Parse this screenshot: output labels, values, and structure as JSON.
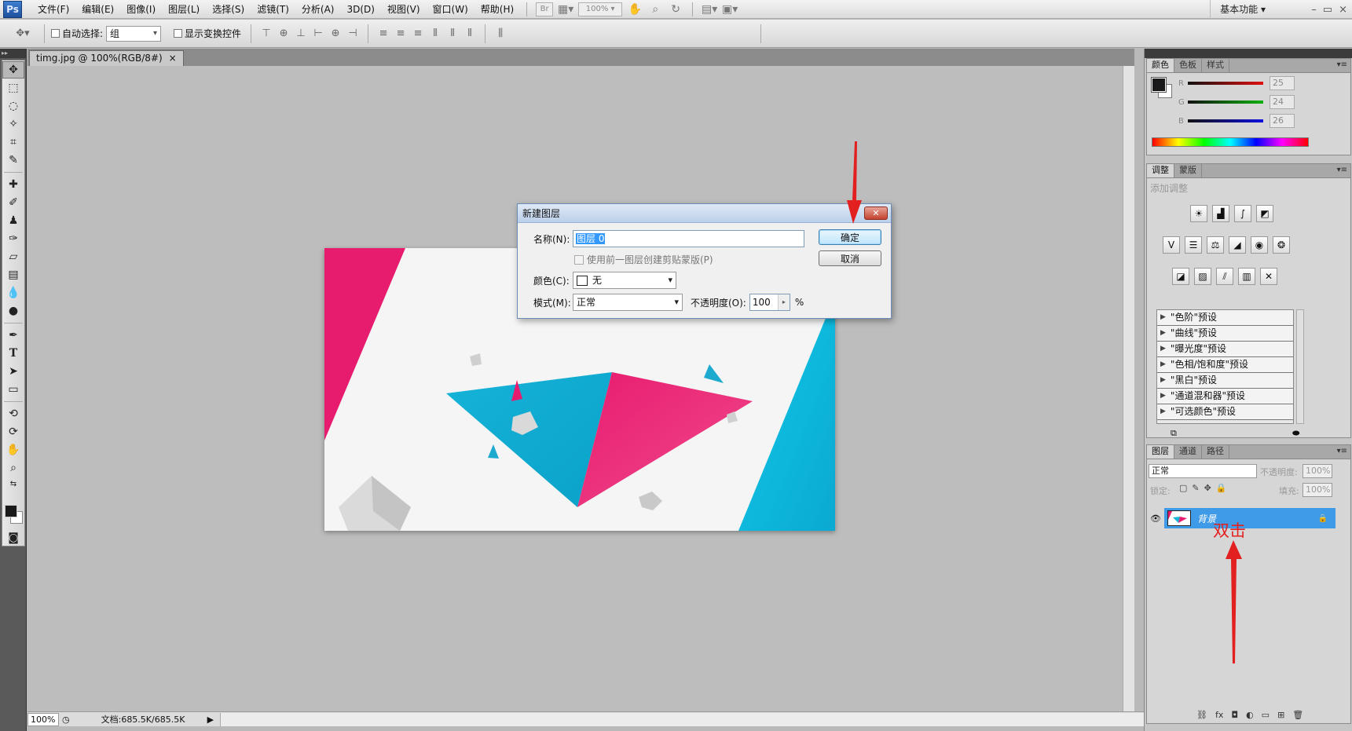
{
  "app": {
    "logo": "Ps",
    "menus": [
      "文件(F)",
      "编辑(E)",
      "图像(I)",
      "图层(L)",
      "选择(S)",
      "滤镜(T)",
      "分析(A)",
      "3D(D)",
      "视图(V)",
      "窗口(W)",
      "帮助(H)"
    ],
    "br_button": "Br",
    "zoom_level": "100%",
    "workspace": "基本功能 ▾",
    "window_controls": [
      "–",
      "▭",
      "×"
    ]
  },
  "options": {
    "auto_select_label": "自动选择:",
    "auto_select_value": "组",
    "show_transform_label": "显示变换控件"
  },
  "document": {
    "tab_title": "timg.jpg @ 100%(RGB/8#)",
    "tab_close": "×",
    "status_zoom": "100%",
    "doc_info": "文档:685.5K/685.5K"
  },
  "dialog": {
    "title": "新建图层",
    "close": "✕",
    "name_label": "名称(N):",
    "name_value": "图层 0",
    "clip_mask_label": "使用前一图层创建剪贴蒙版(P)",
    "color_label": "颜色(C):",
    "color_value": "无",
    "mode_label": "模式(M):",
    "mode_value": "正常",
    "opacity_label": "不透明度(O):",
    "opacity_value": "100",
    "opacity_unit": "%",
    "ok_label": "确定",
    "cancel_label": "取消"
  },
  "color_panel": {
    "tabs": [
      "颜色",
      "色板",
      "样式"
    ],
    "channels": [
      {
        "label": "R",
        "value": "25",
        "color": "#e01010"
      },
      {
        "label": "G",
        "value": "24",
        "color": "#10b010"
      },
      {
        "label": "B",
        "value": "26",
        "color": "#1010e0"
      }
    ],
    "foreground": "#19181a"
  },
  "adjust_panel": {
    "tabs": [
      "调整",
      "蒙版"
    ],
    "header": "添加调整",
    "presets": [
      "\"色阶\"预设",
      "\"曲线\"预设",
      "\"曝光度\"预设",
      "\"色相/饱和度\"预设",
      "\"黑白\"预设",
      "\"通道混和器\"预设",
      "\"可选颜色\"预设"
    ]
  },
  "layers_panel": {
    "tabs": [
      "图层",
      "通道",
      "路径"
    ],
    "blend_mode": "正常",
    "opacity_label": "不透明度:",
    "opacity_value": "100%",
    "lock_label": "锁定:",
    "fill_label": "填充:",
    "fill_value": "100%",
    "layer_name": "背景"
  },
  "annotation": {
    "text": "双击",
    "color": "#e32020"
  }
}
